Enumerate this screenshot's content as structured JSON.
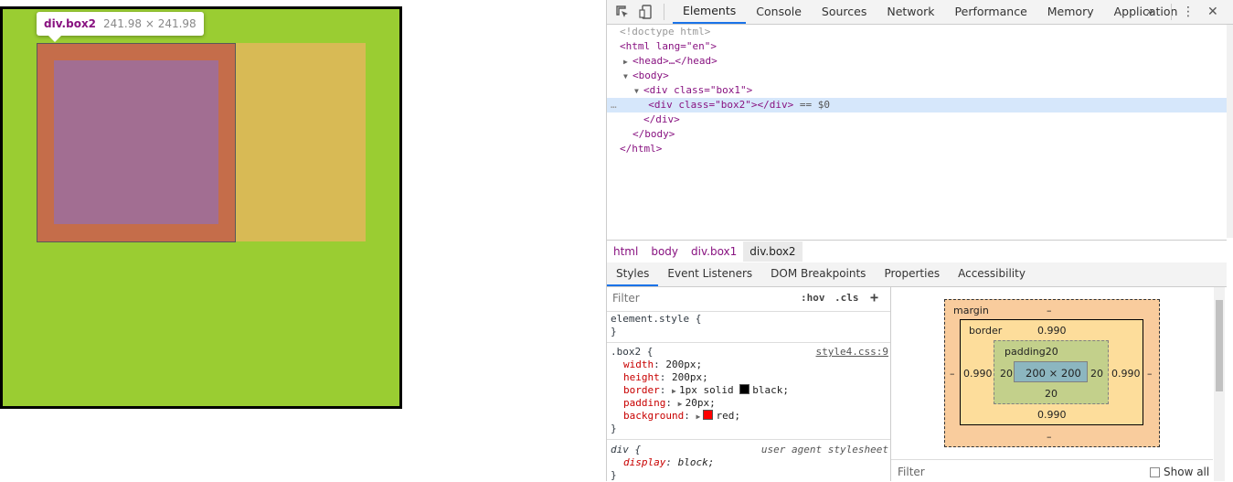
{
  "page": {
    "tooltip": {
      "name": "div.box2",
      "size": "241.98 × 241.98"
    }
  },
  "devtools": {
    "tabs": [
      "Elements",
      "Console",
      "Sources",
      "Network",
      "Performance",
      "Memory",
      "Application"
    ],
    "active_tab": "Elements",
    "more_tabs": "»",
    "menu": "⋮",
    "close": "✕",
    "dom": {
      "doctype": "<!doctype html>",
      "html_open": "<html lang=\"en\">",
      "head": "<head>…</head>",
      "body_open": "<body>",
      "box1_open": "<div class=\"box1\">",
      "box2": "<div class=\"box2\"></div>",
      "selected_marker": "== $0",
      "ellipsis": "…",
      "div_close": "</div>",
      "body_close": "</body>",
      "html_close": "</html>"
    },
    "breadcrumbs": [
      "html",
      "body",
      "div.box1",
      "div.box2"
    ],
    "subtabs": [
      "Styles",
      "Event Listeners",
      "DOM Breakpoints",
      "Properties",
      "Accessibility"
    ],
    "styles": {
      "filter_placeholder": "Filter",
      "hov": ":hov",
      "cls": ".cls",
      "plus": "+",
      "element_style": "element.style {",
      "close_brace": "}",
      "box2_selector": ".box2 {",
      "box2_source": "style4.css:9",
      "box2_props": [
        {
          "name": "width",
          "value": "200px;"
        },
        {
          "name": "height",
          "value": "200px;"
        },
        {
          "name": "border",
          "value": "1px solid",
          "color": "#000000",
          "color_name": "black;"
        },
        {
          "name": "padding",
          "value": "20px;"
        },
        {
          "name": "background",
          "value": "",
          "color": "#ff0000",
          "color_name": "red;"
        }
      ],
      "div_selector": "div {",
      "div_source": "user agent stylesheet",
      "div_props": [
        {
          "name": "display",
          "value": "block;"
        }
      ]
    },
    "box_model": {
      "margin_label": "margin",
      "margin_top": "–",
      "margin_bottom": "–",
      "margin_left": "–",
      "margin_right": "–",
      "border_label": "border",
      "border_top": "0.990",
      "border_bottom": "0.990",
      "border_left": "0.990",
      "border_right": "0.990",
      "padding_label": "padding20",
      "padding_bottom": "20",
      "padding_left": "20",
      "padding_right": "20",
      "content": "200 × 200"
    },
    "computed_filter": "Filter",
    "show_all": "Show all"
  }
}
